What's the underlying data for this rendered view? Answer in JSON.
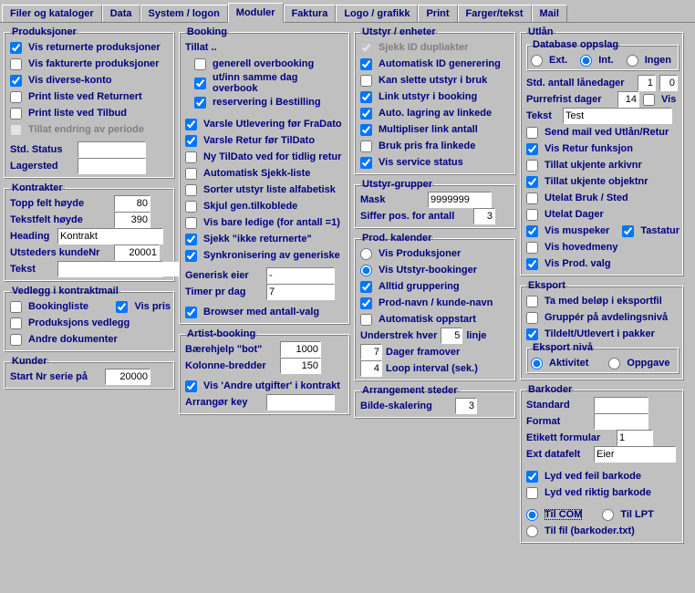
{
  "tabs": {
    "t0": "Filer og kataloger",
    "t1": "Data",
    "t2": "System / logon",
    "t3": "Moduler",
    "t4": "Faktura",
    "t5": "Logo / grafikk",
    "t6": "Print",
    "t7": "Farger/tekst",
    "t8": "Mail"
  },
  "produksjoner": {
    "legend": "Produksjoner",
    "vis_returnerte": "Vis returnerte produksjoner",
    "vis_fakturerte": "Vis fakturerte produksjoner",
    "vis_diverse": "Vis diverse-konto",
    "print_returnert": "Print liste ved Returnert",
    "print_tilbud": "Print liste ved Tilbud",
    "tillat_endring": "Tillat endring av periode",
    "std_status": "Std. Status",
    "lagersted": "Lagersted"
  },
  "kontrakter": {
    "legend": "Kontrakter",
    "topp_felt": "Topp felt høyde",
    "topp_felt_val": "80",
    "tekstfelt": "Tekstfelt høyde",
    "tekstfelt_val": "390",
    "heading": "Heading",
    "heading_val": "Kontrakt",
    "utsteders": "Utsteders kundeNr",
    "utsteders_val": "20001",
    "tekst": "Tekst"
  },
  "vedlegg": {
    "legend": "Vedlegg i kontraktmail",
    "bookingliste": "Bookingliste",
    "vis_pris": "Vis pris",
    "prod_vedlegg": "Produksjons vedlegg",
    "andre_dok": "Andre dokumenter"
  },
  "kunder": {
    "legend": "Kunder",
    "start_nr": "Start Nr serie på",
    "start_nr_val": "20000"
  },
  "booking": {
    "legend": "Booking",
    "tillat": "Tillat ..",
    "generell_over": "generell overbooking",
    "utinn": "ut/inn samme dag overbook",
    "reservering": "reservering i Bestilling",
    "varsle_utlev": "Varsle Utlevering før FraDato",
    "varsle_retur": "Varsle Retur før TilDato",
    "ny_tildato": "Ny TilDato ved for tidlig retur",
    "auto_sjekk": "Automatisk Sjekk-liste",
    "sorter": "Sorter utstyr liste alfabetisk",
    "skjul_gen": "Skjul gen.tilkoblede",
    "vis_bare": "Vis bare ledige (for antall =1)",
    "sjekk_ikke": "Sjekk \"ikke returnerte\"",
    "synk": "Synkronisering av generiske",
    "generisk_eier": "Generisk eier",
    "generisk_eier_val": "-",
    "timer_pr_dag": "Timer pr dag",
    "timer_pr_dag_val": "7",
    "browser_antall": "Browser med antall-valg"
  },
  "artist": {
    "legend": "Artist-booking",
    "baerehjelp": "Bærehjelp \"bot\"",
    "baerehjelp_val": "1000",
    "kolonne": "Kolonne-bredder",
    "kolonne_val": "150",
    "vis_andre": "Vis 'Andre utgifter' i kontrakt",
    "arrangor": "Arrangør key"
  },
  "utstyr": {
    "legend": "Utstyr / enheter",
    "sjekk_id": "Sjekk ID dupliakter",
    "auto_id": "Automatisk ID generering",
    "kan_slette": "Kan slette utstyr i bruk",
    "link_utstyr": "Link utstyr i booking",
    "auto_lagring": "Auto. lagring av linkede",
    "multipliser": "Multipliser link antall",
    "bruk_pris": "Bruk pris fra linkede",
    "vis_service": "Vis service status"
  },
  "utstyr_grupper": {
    "legend": "Utstyr-grupper",
    "mask": "Mask",
    "mask_val": "9999999",
    "siffer": "Siffer pos. for antall",
    "siffer_val": "3"
  },
  "prod_kalender": {
    "legend": "Prod. kalender",
    "vis_produksjoner": "Vis Produksjoner",
    "vis_utstyr_book": "Vis Utstyr-bookinger",
    "alltid_grupp": "Alltid gruppering",
    "prod_navn": "Prod-navn / kunde-navn",
    "auto_opp": "Automatisk oppstart",
    "understrek": "Understrek hver",
    "understrek_val": "5",
    "linje": "linje",
    "dager_fram": "Dager framover",
    "dager_fram_val": "7",
    "loop": "Loop interval (sek.)",
    "loop_val": "4"
  },
  "arrangement": {
    "legend": "Arrangement steder",
    "bilde_skal": "Bilde-skalering",
    "bilde_skal_val": "3"
  },
  "utlan": {
    "legend": "Utlån",
    "db_oppslag": "Database oppslag",
    "ext": "Ext.",
    "int": "Int.",
    "ingen": "Ingen",
    "std_antall": "Std. antall lånedager",
    "std_antall_val": "1",
    "std_antall_val2": "0",
    "purrefrist": "Purrefrist dager",
    "purrefrist_val": "14",
    "vis": "Vis",
    "tekst": "Tekst",
    "tekst_val": "Test",
    "send_mail": "Send mail ved Utlån/Retur",
    "vis_retur": "Vis Retur funksjon",
    "tillat_arkiv": "Tillat ukjente arkivnr",
    "tillat_objekt": "Tillat ukjente objektnr",
    "utelat_bruk": "Utelat Bruk / Sted",
    "utelat_dager": "Utelat Dager",
    "vis_muspeker": "Vis muspeker",
    "tastatur": "Tastatur",
    "vis_hovedmeny": "Vis hovedmeny",
    "vis_prod_valg": "Vis Prod. valg"
  },
  "eksport": {
    "legend": "Eksport",
    "ta_med": "Ta med beløp i eksportfil",
    "gruppe": "Gruppér på avdelingsnivå",
    "tildelt": "Tildelt/Utlevert i pakker",
    "nivaa": "Eksport nivå",
    "aktivitet": "Aktivitet",
    "oppgave": "Oppgave"
  },
  "barkoder": {
    "legend": "Barkoder",
    "standard": "Standard",
    "format": "Format",
    "etikett": "Etikett formular",
    "etikett_val": "1",
    "ext_datafelt": "Ext datafelt",
    "ext_datafelt_val": "Eier",
    "lyd_feil": "Lyd ved feil barkode",
    "lyd_riktig": "Lyd ved riktig barkode",
    "til_com": "Til COM",
    "til_lpt": "Til LPT",
    "til_fil": "Til fil (barkoder.txt)"
  }
}
